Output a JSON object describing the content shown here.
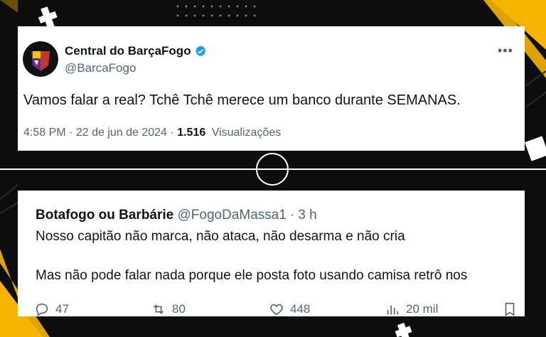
{
  "main_tweet": {
    "author_name": "Central do BarçaFogo",
    "handle": "@BarcaFogo",
    "text": "Vamos falar a real? Tchê Tchê merece um banco durante SEMANAS.",
    "time": "4:58 PM",
    "date": "22 de jun de 2024",
    "views_count": "1.516",
    "views_label": "Visualizações",
    "more_icon": "more-dots-icon"
  },
  "reply_tweet": {
    "author_name": "Botafogo ou Barbárie",
    "handle": "@FogoDaMassa1",
    "separator": "·",
    "time": "3 h",
    "line1": "Nosso capitão não marca, não ataca, não desarma e não cria",
    "line2": "Mas não pode falar nada porque ele posta foto usando camisa retrô nos",
    "replies": "47",
    "retweets": "80",
    "likes": "448",
    "views": "20 mil"
  },
  "colors": {
    "accent_yellow": "#f5b400",
    "verified_blue": "#1d9bf0",
    "text_primary": "#0f1419",
    "text_secondary": "#536471"
  }
}
